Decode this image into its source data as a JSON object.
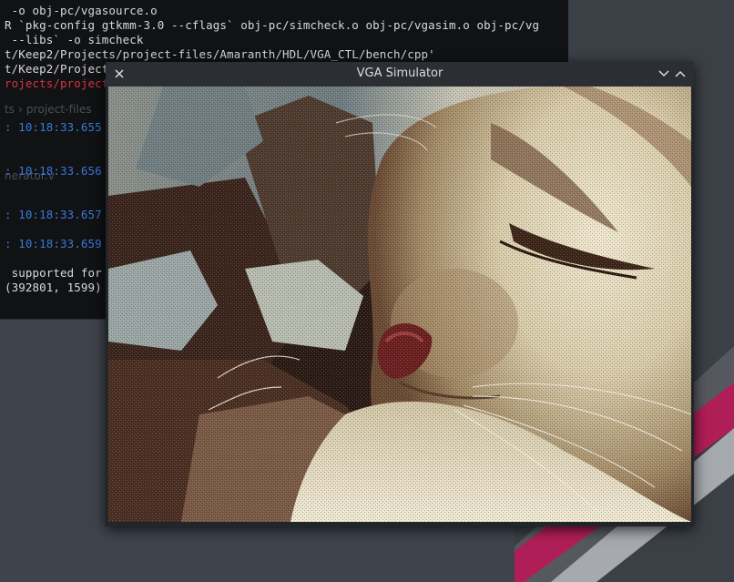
{
  "terminal": {
    "lines": [
      " -o obj-pc/vgasource.o",
      "R `pkg-config gtkmm-3.0 --cflags` obj-pc/simcheck.o obj-pc/vgasim.o obj-pc/vg",
      " --libs` -o simcheck",
      "t/Keep2/Projects/project-files/Amaranth/HDL/VGA_CTL/bench/cpp'",
      "t/Keep2/Project",
      "rojects/project",
      "ts › project-files",
      ": 10:18:33.655",
      "nerator.v",
      ": 10:18:33.656",
      ": 10:18:33.657",
      ": 10:18:33.659",
      " supported for",
      "(392801, 1599)"
    ]
  },
  "window": {
    "title": "VGA Simulator",
    "close_icon": "close-icon",
    "minimize_icon": "chevron-down-icon",
    "maximize_icon": "chevron-up-icon"
  },
  "colors": {
    "wallpaper": "#3f444c",
    "accent_stripe": "#b01e58",
    "terminal_bg": "#101214",
    "titlebar": "#2b2e33"
  }
}
